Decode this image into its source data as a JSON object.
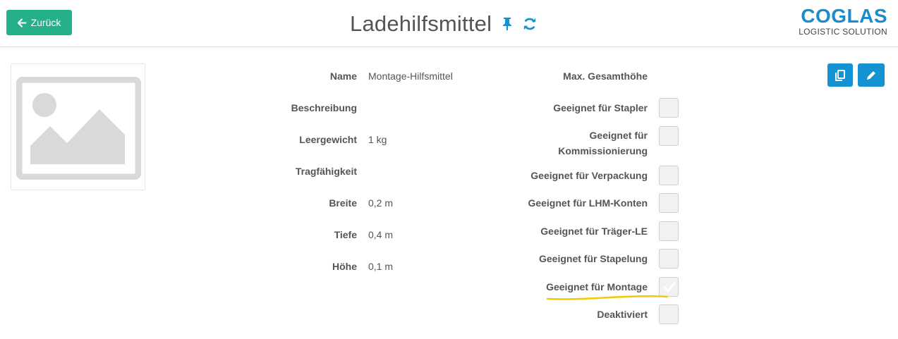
{
  "header": {
    "back_label": "Zurück",
    "title": "Ladehilfsmittel",
    "pin_icon": "pin-icon",
    "refresh_icon": "refresh-icon",
    "logo_main": "COGLAS",
    "logo_sub": "LOGISTIC SOLUTION",
    "accent_color": "#1a8ccb",
    "back_color": "#26b08a"
  },
  "details": [
    {
      "label": "Name",
      "value": "Montage-Hilfsmittel"
    },
    {
      "label": "Beschreibung",
      "value": ""
    },
    {
      "label": "Leergewicht",
      "value": "1 kg"
    },
    {
      "label": "Tragfähigkeit",
      "value": ""
    },
    {
      "label": "Breite",
      "value": "0,2 m"
    },
    {
      "label": "Tiefe",
      "value": "0,4 m"
    },
    {
      "label": "Höhe",
      "value": "0,1 m"
    }
  ],
  "max_height_label": "Max. Gesamthöhe",
  "flags": [
    {
      "label": "Geeignet für Stapler",
      "checked": false
    },
    {
      "label_line1": "Geeignet für",
      "label_line2": "Kommissionierung",
      "checked": false
    },
    {
      "label": "Geeignet für Verpackung",
      "checked": false
    },
    {
      "label": "Geeignet für LHM-Konten",
      "checked": false
    },
    {
      "label": "Geeignet für Träger-LE",
      "checked": false
    },
    {
      "label": "Geeignet für Stapelung",
      "checked": false
    },
    {
      "label": "Geeignet für Montage",
      "checked": true
    },
    {
      "label": "Deaktiviert",
      "checked": false
    }
  ],
  "actions": {
    "copy_icon": "copy-icon",
    "edit_icon": "edit-icon"
  },
  "highlight_color": "#f5c800"
}
